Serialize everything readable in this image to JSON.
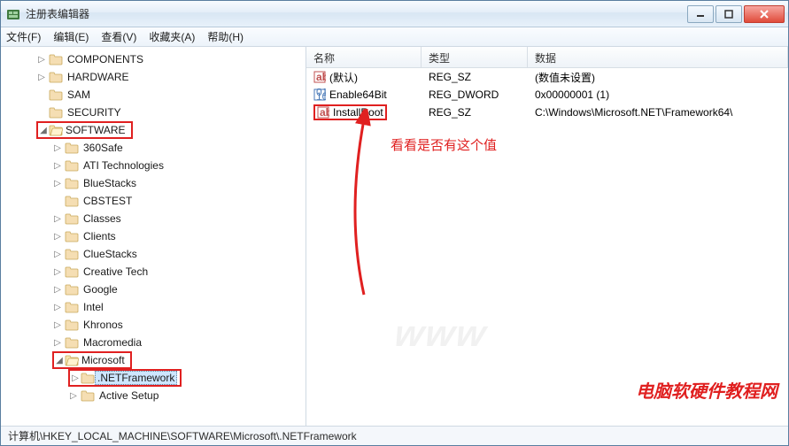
{
  "window": {
    "title": "注册表编辑器"
  },
  "menu": {
    "file": "文件(F)",
    "edit": "编辑(E)",
    "view": "查看(V)",
    "favorites": "收藏夹(A)",
    "help": "帮助(H)"
  },
  "tree": {
    "items": [
      {
        "label": "COMPONENTS",
        "depth": 2,
        "expander": "▷"
      },
      {
        "label": "HARDWARE",
        "depth": 2,
        "expander": "▷"
      },
      {
        "label": "SAM",
        "depth": 2,
        "expander": ""
      },
      {
        "label": "SECURITY",
        "depth": 2,
        "expander": ""
      },
      {
        "label": "SOFTWARE",
        "depth": 2,
        "expander": "◢",
        "highlight": true
      },
      {
        "label": "360Safe",
        "depth": 3,
        "expander": "▷"
      },
      {
        "label": "ATI Technologies",
        "depth": 3,
        "expander": "▷"
      },
      {
        "label": "BlueStacks",
        "depth": 3,
        "expander": "▷"
      },
      {
        "label": "CBSTEST",
        "depth": 3,
        "expander": ""
      },
      {
        "label": "Classes",
        "depth": 3,
        "expander": "▷"
      },
      {
        "label": "Clients",
        "depth": 3,
        "expander": "▷"
      },
      {
        "label": "ClueStacks",
        "depth": 3,
        "expander": "▷"
      },
      {
        "label": "Creative Tech",
        "depth": 3,
        "expander": "▷"
      },
      {
        "label": "Google",
        "depth": 3,
        "expander": "▷"
      },
      {
        "label": "Intel",
        "depth": 3,
        "expander": "▷"
      },
      {
        "label": "Khronos",
        "depth": 3,
        "expander": "▷"
      },
      {
        "label": "Macromedia",
        "depth": 3,
        "expander": "▷"
      },
      {
        "label": "Microsoft",
        "depth": 3,
        "expander": "◢",
        "highlight": true
      },
      {
        "label": ".NETFramework",
        "depth": 4,
        "expander": "▷",
        "highlight": true,
        "selected": true
      },
      {
        "label": "Active Setup",
        "depth": 4,
        "expander": "▷"
      }
    ]
  },
  "list": {
    "headers": {
      "name": "名称",
      "type": "类型",
      "data": "数据"
    },
    "rows": [
      {
        "icon": "string",
        "name": "(默认)",
        "type": "REG_SZ",
        "data": "(数值未设置)"
      },
      {
        "icon": "binary",
        "name": "Enable64Bit",
        "type": "REG_DWORD",
        "data": "0x00000001 (1)"
      },
      {
        "icon": "string",
        "name": "InstallRoot",
        "type": "REG_SZ",
        "data": "C:\\Windows\\Microsoft.NET\\Framework64\\",
        "highlight": true
      }
    ]
  },
  "annotation": {
    "text": "看看是否有这个值"
  },
  "statusbar": {
    "path": "计算机\\HKEY_LOCAL_MACHINE\\SOFTWARE\\Microsoft\\.NETFramework"
  },
  "watermarks": {
    "site": "电脑软硬件教程网"
  }
}
